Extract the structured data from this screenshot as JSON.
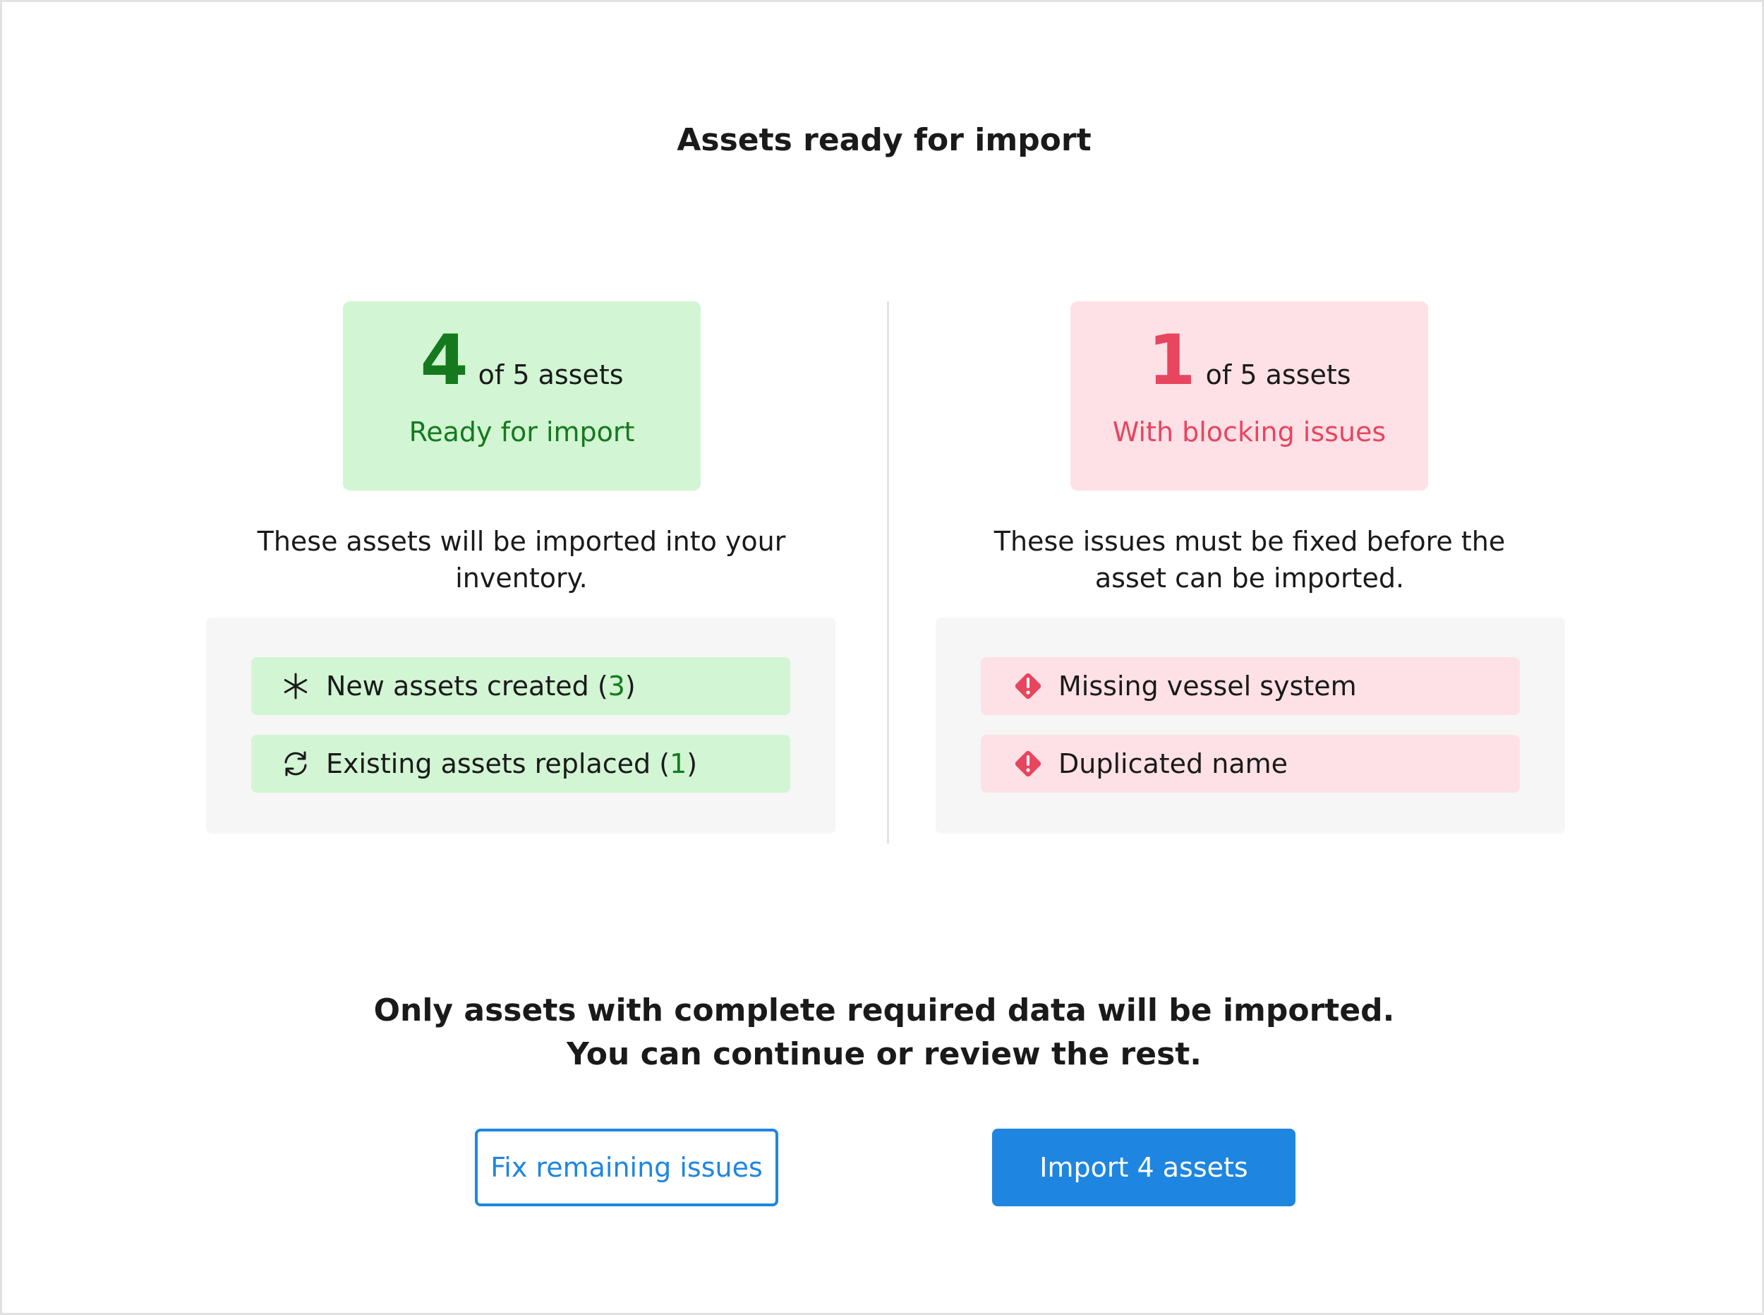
{
  "page": {
    "title": "Assets ready for import"
  },
  "ready": {
    "count": "4",
    "of_total": "of 5 assets",
    "label": "Ready for import",
    "description": "These assets will be imported into your inventory.",
    "items": [
      {
        "icon": "asterisk-icon",
        "label": "New assets created (",
        "count": "3",
        "close": ")"
      },
      {
        "icon": "refresh-icon",
        "label": "Existing assets replaced (",
        "count": "1",
        "close": ")"
      }
    ]
  },
  "blocking": {
    "count": "1",
    "of_total": "of 5 assets",
    "label": "With blocking issues",
    "description": "These issues must be fixed before the asset can be imported.",
    "items": [
      {
        "icon": "warning-diamond-icon",
        "label": "Missing vessel system"
      },
      {
        "icon": "warning-diamond-icon",
        "label": "Duplicated name"
      }
    ]
  },
  "note": {
    "line1": "Only assets with complete required data will be imported.",
    "line2": "You can continue or review the rest."
  },
  "actions": {
    "secondary_label": "Fix remaining issues",
    "primary_label": "Import 4 assets"
  },
  "colors": {
    "success": "#147a1d",
    "success_bg": "#d2f5d4",
    "danger": "#e8455f",
    "danger_bg": "#fee1e6",
    "primary": "#1e86e0"
  }
}
